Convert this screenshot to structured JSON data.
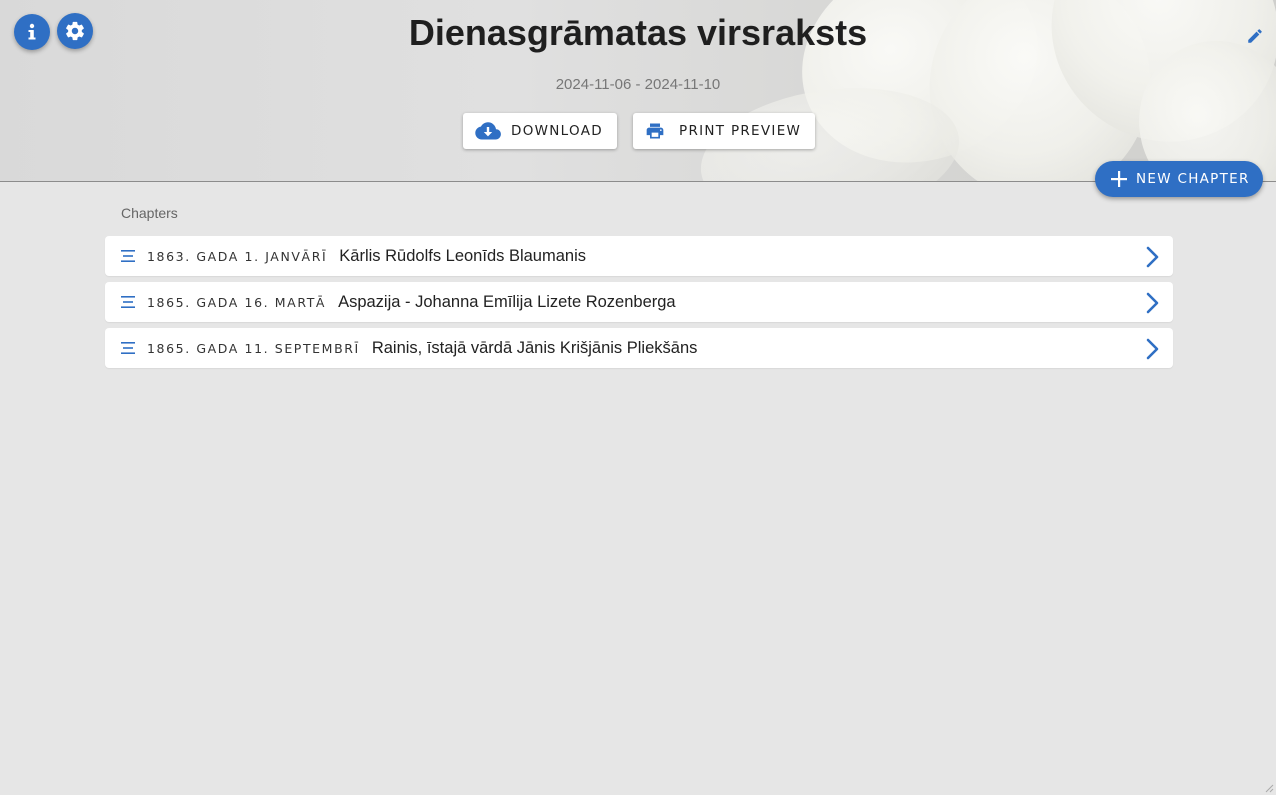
{
  "header": {
    "title": "Dienasgrāmatas virsraksts",
    "dates": "2024-11-06 - 2024-11-10",
    "download_label": "DOWNLOAD",
    "print_label": "PRINT PREVIEW",
    "icons": [
      "info-icon",
      "gear-icon",
      "pencil-icon",
      "cloud-download-icon",
      "printer-icon"
    ]
  },
  "fab": {
    "new_chapter_label": "NEW CHAPTER",
    "icon": "plus-icon"
  },
  "chapters": {
    "label": "Chapters",
    "items": [
      {
        "date": "1863. GADA 1. JANVĀRĪ",
        "title": "Kārlis Rūdolfs Leonīds Blaumanis"
      },
      {
        "date": "1865. GADA 16. MARTĀ",
        "title": "Aspazija - Johanna Emīlija Lizete Rozenberga"
      },
      {
        "date": "1865. GADA 11. SEPTEMBRĪ",
        "title": "Rainis, īstajā vārdā Jānis Krišjānis Pliekšāns"
      }
    ]
  },
  "colors": {
    "accent": "#2f6fc4",
    "background": "#e6e6e6",
    "card": "#ffffff"
  }
}
